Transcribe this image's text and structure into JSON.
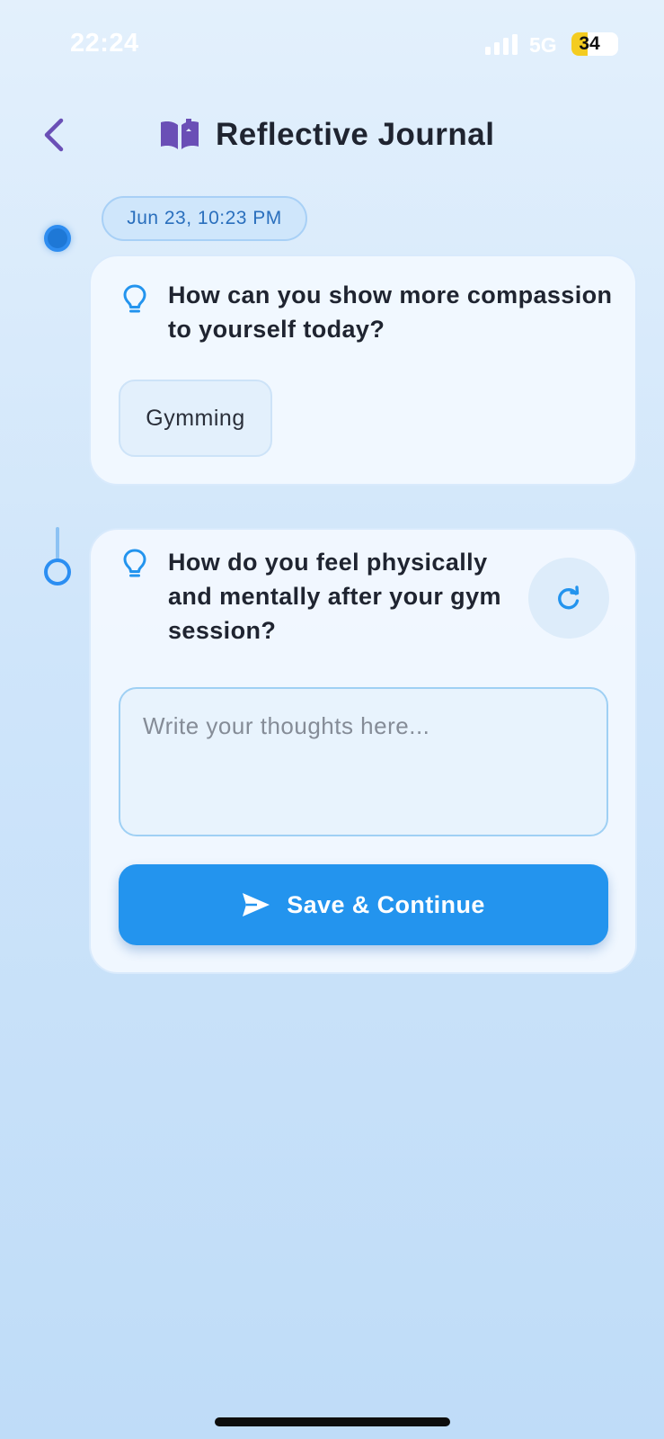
{
  "status_bar": {
    "time": "22:24",
    "network": "5G",
    "battery_level": 34,
    "battery_text": "34",
    "battery_color": "#f4cc20"
  },
  "header": {
    "back_icon": "chevron-left-icon",
    "title_icon": "book-open-icon",
    "title": "Reflective Journal",
    "accent_color": "#6a4fb6"
  },
  "timeline": {
    "date": "Jun 23, 10:23 PM",
    "entries": [
      {
        "icon": "lightbulb-icon",
        "question": "How can you show more compassion to yourself today?",
        "answer": "Gymming"
      },
      {
        "icon": "lightbulb-icon",
        "question": "How do you feel physically and mentally after your gym session?",
        "input_value": "",
        "input_placeholder": "Write your thoughts here...",
        "refresh_icon": "refresh-icon",
        "save_icon": "send-icon",
        "save_label": "Save & Continue"
      }
    ]
  },
  "colors": {
    "primary": "#2394ee",
    "bulb": "#2394ee",
    "background_top": "#e3f0fc",
    "background_bottom": "#bfdcf8"
  }
}
